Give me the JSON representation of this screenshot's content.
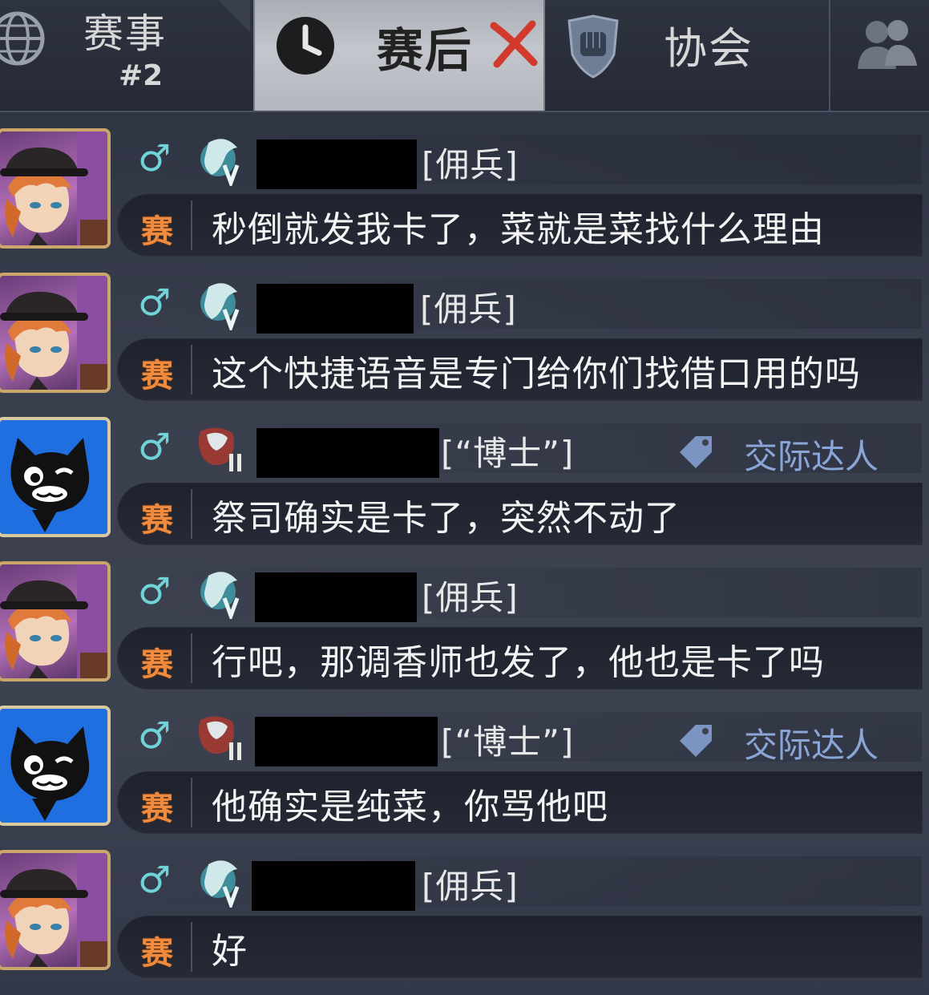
{
  "tabs": {
    "events": {
      "label": "赛事",
      "sub": "#2",
      "icon": "globe-icon"
    },
    "post_match": {
      "label": "赛后",
      "icon": "clock-icon",
      "close_icon": "close-icon",
      "active": true
    },
    "guild": {
      "label": "协会",
      "icon": "fist-shield-icon"
    },
    "friends": {
      "icon": "people-icon"
    }
  },
  "colors": {
    "gender": "#6fd4d8",
    "channel": "#f08a3c",
    "tag": "#8aa6d8",
    "active_tab": "#c3c6cc"
  },
  "messages": [
    {
      "avatar": "chuuya-avatar",
      "gender": "♂",
      "badge": "rank-badge-v",
      "role": "[佣兵]",
      "tag": "",
      "channel": "赛",
      "text": "秒倒就发我卡了，菜就是菜找什么理由"
    },
    {
      "avatar": "chuuya-avatar",
      "gender": "♂",
      "badge": "rank-badge-v",
      "role": "[佣兵]",
      "tag": "",
      "channel": "赛",
      "text": "这个快捷语音是专门给你们找借口用的吗"
    },
    {
      "avatar": "cat-avatar",
      "gender": "♂",
      "badge": "rank-badge-ii",
      "role": "[“博士”]",
      "tag": "交际达人",
      "channel": "赛",
      "text": "祭司确实是卡了，突然不动了"
    },
    {
      "avatar": "chuuya-avatar",
      "gender": "♂",
      "badge": "rank-badge-v",
      "role": "[佣兵]",
      "tag": "",
      "channel": "赛",
      "text": "行吧，那调香师也发了，他也是卡了吗"
    },
    {
      "avatar": "cat-avatar",
      "gender": "♂",
      "badge": "rank-badge-ii",
      "role": "[“博士”]",
      "tag": "交际达人",
      "channel": "赛",
      "text": "他确实是纯菜，你骂他吧"
    },
    {
      "avatar": "chuuya-avatar",
      "gender": "♂",
      "badge": "rank-badge-v",
      "role": "[佣兵]",
      "tag": "",
      "channel": "赛",
      "text": "好"
    }
  ]
}
